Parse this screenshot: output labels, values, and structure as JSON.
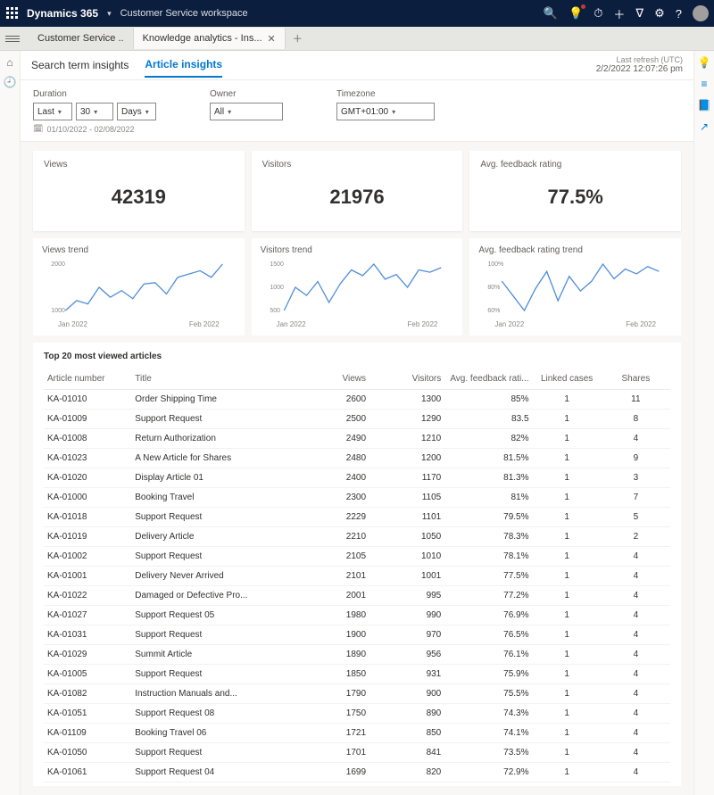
{
  "topbar": {
    "brand": "Dynamics 365",
    "workspace": "Customer Service workspace"
  },
  "window_tabs": {
    "tab1": "Customer Service ..",
    "tab2": "Knowledge analytics - Ins..."
  },
  "subnav": {
    "search_tab": "Search term insights",
    "article_tab": "Article insights"
  },
  "refresh": {
    "label": "Last refresh (UTC)",
    "value": "2/2/2022 12:07:26 pm"
  },
  "filters": {
    "duration_label": "Duration",
    "last": "Last",
    "num": "30",
    "unit": "Days",
    "owner_label": "Owner",
    "owner": "All",
    "tz_label": "Timezone",
    "tz": "GMT+01:00",
    "date_range": "01/10/2022 - 02/08/2022"
  },
  "kpi": {
    "views_label": "Views",
    "views": "42319",
    "visitors_label": "Visitors",
    "visitors": "21976",
    "feedback_label": "Avg. feedback rating",
    "feedback": "77.5%"
  },
  "trends": {
    "views_label": "Views trend",
    "visitors_label": "Visitors trend",
    "feedback_label": "Avg. feedback rating trend",
    "x_start": "Jan 2022",
    "x_end": "Feb 2022"
  },
  "chart_data": {
    "views_trend": {
      "type": "line",
      "y_ticks": [
        "1000",
        "2000"
      ],
      "x": [
        "Jan 2022",
        "Feb 2022"
      ],
      "values": [
        1200,
        1350,
        1300,
        1550,
        1400,
        1500,
        1380,
        1600,
        1620,
        1450,
        1700,
        1750,
        1800,
        1700,
        1900
      ]
    },
    "visitors_trend": {
      "type": "line",
      "y_ticks": [
        "500",
        "1000",
        "1500"
      ],
      "x": [
        "Jan 2022",
        "Feb 2022"
      ],
      "values": [
        650,
        850,
        780,
        900,
        720,
        880,
        1000,
        950,
        1050,
        920,
        960,
        850,
        1000,
        980,
        1020
      ]
    },
    "feedback_trend": {
      "type": "line",
      "y_ticks": [
        "60%",
        "80%",
        "100%"
      ],
      "x": [
        "Jan 2022",
        "Feb 2022"
      ],
      "values": [
        78,
        72,
        66,
        75,
        82,
        70,
        80,
        74,
        78,
        85,
        79,
        83,
        81,
        84,
        82
      ]
    }
  },
  "table": {
    "title": "Top 20 most viewed articles",
    "headers": {
      "an": "Article number",
      "title": "Title",
      "views": "Views",
      "visitors": "Visitors",
      "afr": "Avg. feedback rati...",
      "lc": "Linked cases",
      "shares": "Shares"
    },
    "rows": [
      {
        "an": "KA-01010",
        "title": "Order Shipping Time",
        "views": "2600",
        "visitors": "1300",
        "afr": "85%",
        "lc": "1",
        "shares": "11"
      },
      {
        "an": "KA-01009",
        "title": "Support Request",
        "views": "2500",
        "visitors": "1290",
        "afr": "83.5",
        "lc": "1",
        "shares": "8"
      },
      {
        "an": "KA-01008",
        "title": "Return Authorization",
        "views": "2490",
        "visitors": "1210",
        "afr": "82%",
        "lc": "1",
        "shares": "4"
      },
      {
        "an": "KA-01023",
        "title": "A New Article for Shares",
        "views": "2480",
        "visitors": "1200",
        "afr": "81.5%",
        "lc": "1",
        "shares": "9"
      },
      {
        "an": "KA-01020",
        "title": "Display Article 01",
        "views": "2400",
        "visitors": "1170",
        "afr": "81.3%",
        "lc": "1",
        "shares": "3"
      },
      {
        "an": "KA-01000",
        "title": "Booking Travel",
        "views": "2300",
        "visitors": "1105",
        "afr": "81%",
        "lc": "1",
        "shares": "7"
      },
      {
        "an": "KA-01018",
        "title": "Support Request",
        "views": "2229",
        "visitors": "1101",
        "afr": "79.5%",
        "lc": "1",
        "shares": "5"
      },
      {
        "an": "KA-01019",
        "title": "Delivery Article",
        "views": "2210",
        "visitors": "1050",
        "afr": "78.3%",
        "lc": "1",
        "shares": "2"
      },
      {
        "an": "KA-01002",
        "title": "Support Request",
        "views": "2105",
        "visitors": "1010",
        "afr": "78.1%",
        "lc": "1",
        "shares": "4"
      },
      {
        "an": "KA-01001",
        "title": "Delivery Never Arrived",
        "views": "2101",
        "visitors": "1001",
        "afr": "77.5%",
        "lc": "1",
        "shares": "4"
      },
      {
        "an": "KA-01022",
        "title": "Damaged or Defective Pro...",
        "views": "2001",
        "visitors": "995",
        "afr": "77.2%",
        "lc": "1",
        "shares": "4"
      },
      {
        "an": "KA-01027",
        "title": "Support Request 05",
        "views": "1980",
        "visitors": "990",
        "afr": "76.9%",
        "lc": "1",
        "shares": "4"
      },
      {
        "an": "KA-01031",
        "title": "Support Request",
        "views": "1900",
        "visitors": "970",
        "afr": "76.5%",
        "lc": "1",
        "shares": "4"
      },
      {
        "an": "KA-01029",
        "title": "Summit Article",
        "views": "1890",
        "visitors": "956",
        "afr": "76.1%",
        "lc": "1",
        "shares": "4"
      },
      {
        "an": "KA-01005",
        "title": "Support Request",
        "views": "1850",
        "visitors": "931",
        "afr": "75.9%",
        "lc": "1",
        "shares": "4"
      },
      {
        "an": "KA-01082",
        "title": "Instruction Manuals and...",
        "views": "1790",
        "visitors": "900",
        "afr": "75.5%",
        "lc": "1",
        "shares": "4"
      },
      {
        "an": "KA-01051",
        "title": "Support Request 08",
        "views": "1750",
        "visitors": "890",
        "afr": "74.3%",
        "lc": "1",
        "shares": "4"
      },
      {
        "an": "KA-01109",
        "title": "Booking Travel 06",
        "views": "1721",
        "visitors": "850",
        "afr": "74.1%",
        "lc": "1",
        "shares": "4"
      },
      {
        "an": "KA-01050",
        "title": "Support Request",
        "views": "1701",
        "visitors": "841",
        "afr": "73.5%",
        "lc": "1",
        "shares": "4"
      },
      {
        "an": "KA-01061",
        "title": "Support Request 04",
        "views": "1699",
        "visitors": "820",
        "afr": "72.9%",
        "lc": "1",
        "shares": "4"
      }
    ]
  }
}
